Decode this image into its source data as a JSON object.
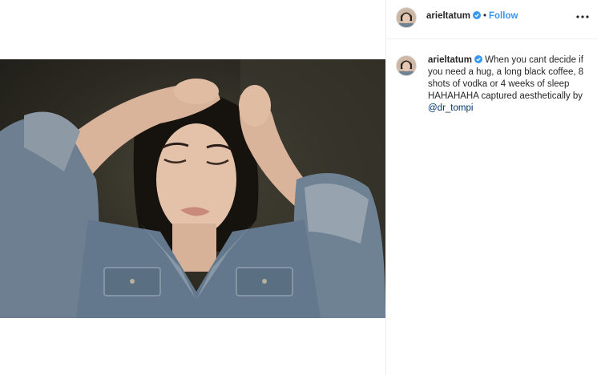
{
  "post": {
    "username": "arieltatum",
    "follow_label": "Follow",
    "separator": "•",
    "caption_text": "When you cant decide if you need a hug, a long black coffee, 8 shots of vodka or 4 weeks of sleep HAHAHAHA captured aesthetically by",
    "mention": "@dr_tompi"
  },
  "icons": {
    "verified": "verified-badge-icon",
    "more": "more-options-icon"
  },
  "colors": {
    "accent": "#3897f0",
    "mention": "#003569",
    "divider": "#efefef"
  }
}
